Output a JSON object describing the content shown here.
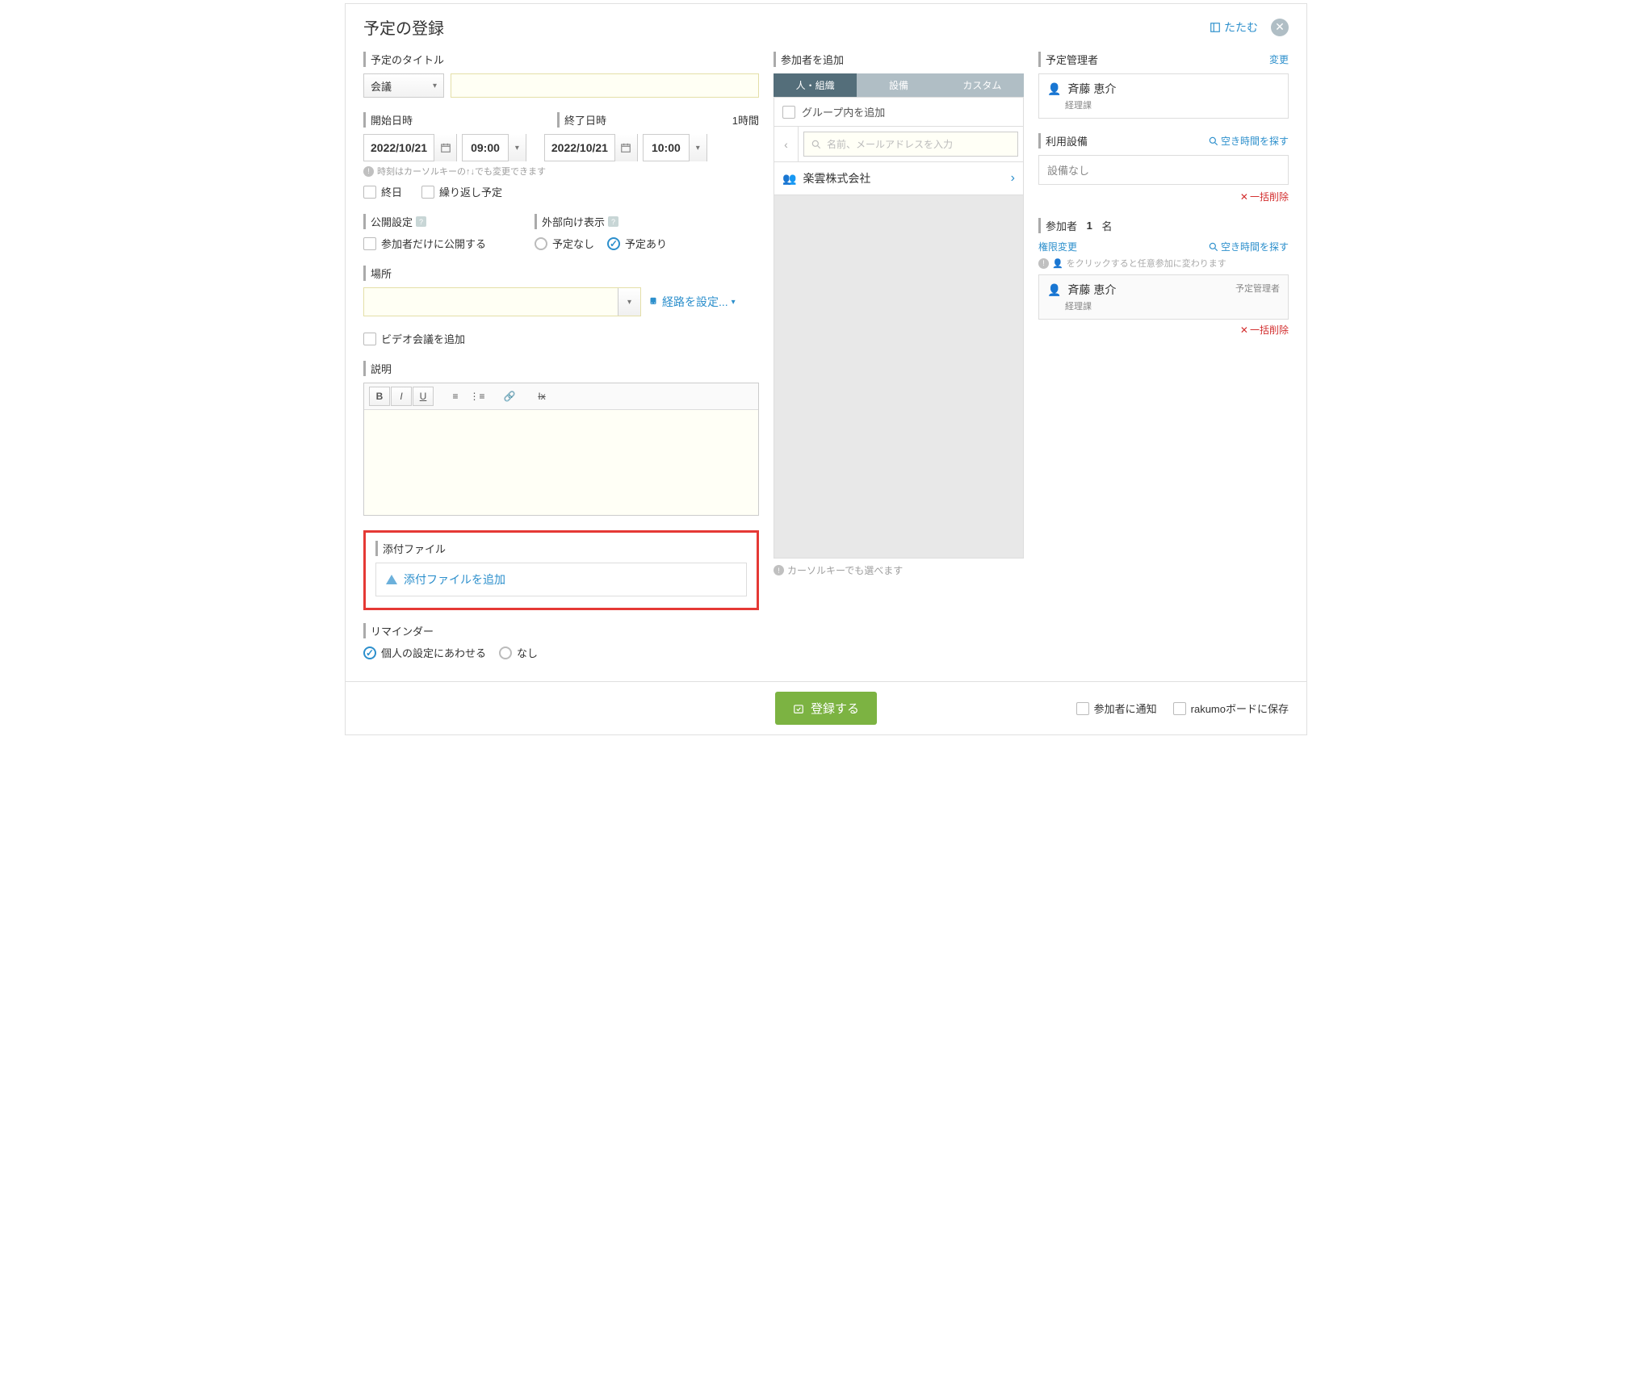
{
  "header": {
    "title": "予定の登録",
    "collapse": "たたむ"
  },
  "left": {
    "title_label": "予定のタイトル",
    "title_type": "会議",
    "start_label": "開始日時",
    "end_label": "終了日時",
    "duration": "1時間",
    "start_date": "2022/10/21",
    "start_time": "09:00",
    "end_date": "2022/10/21",
    "end_time": "10:00",
    "time_hint": "時刻はカーソルキーの↑↓でも変更できます",
    "allday": "終日",
    "repeat": "繰り返し予定",
    "visibility_label": "公開設定",
    "visibility_option": "参加者だけに公開する",
    "external_label": "外部向け表示",
    "external_none": "予定なし",
    "external_busy": "予定あり",
    "location_label": "場所",
    "route_link": "経路を設定...",
    "video_label": "ビデオ会議を追加",
    "description_label": "説明",
    "attach_label": "添付ファイル",
    "attach_action": "添付ファイルを追加",
    "reminder_label": "リマインダー",
    "reminder_personal": "個人の設定にあわせる",
    "reminder_none": "なし"
  },
  "mid": {
    "header": "参加者を追加",
    "tabs": [
      "人・組織",
      "設備",
      "カスタム"
    ],
    "group_add": "グループ内を追加",
    "search_placeholder": "名前、メールアドレスを入力",
    "org_name": "楽雲株式会社",
    "cursor_hint": "カーソルキーでも選べます"
  },
  "right": {
    "manager_label": "予定管理者",
    "change": "変更",
    "manager_name": "斉藤 恵介",
    "manager_dept": "経理課",
    "equipment_label": "利用設備",
    "find_free": "空き時間を探す",
    "no_equipment": "設備なし",
    "bulk_delete": "一括削除",
    "participants_label": "参加者",
    "participant_count": "1",
    "participant_unit": "名",
    "permission_change": "権限変更",
    "optional_hint": "をクリックすると任意参加に変わります",
    "p1_name": "斉藤 恵介",
    "p1_dept": "経理課",
    "p1_role": "予定管理者"
  },
  "footer": {
    "register": "登録する",
    "notify": "参加者に通知",
    "save_board": "rakumoボードに保存"
  }
}
